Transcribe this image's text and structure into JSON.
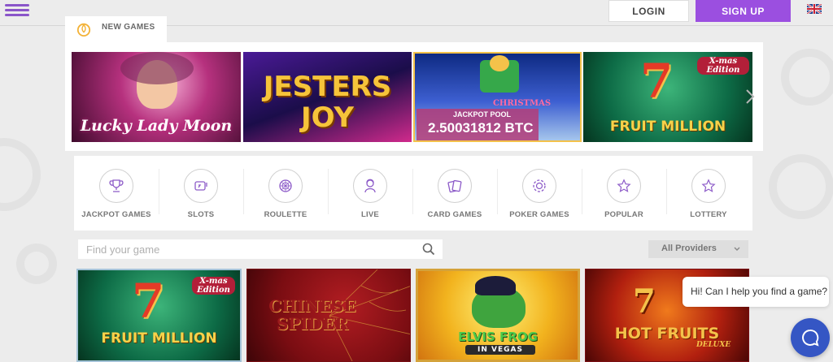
{
  "header": {
    "login_label": "LOGIN",
    "signup_label": "SIGN UP",
    "language_flag": "uk-flag-icon",
    "menu_icon": "hamburger-icon"
  },
  "colors": {
    "accent": "#9b4fe0",
    "menu": "#8a55c9",
    "chat": "#3556c4"
  },
  "new_games": {
    "label": "NEW GAMES",
    "icon": "flame-icon",
    "tiles": [
      {
        "name": "Lucky Lady Moon"
      },
      {
        "name": "JESTERS JOY"
      },
      {
        "name": "CHRISTMAS",
        "jackpot_label": "JACKPOT POOL",
        "jackpot_value": "2.50031812 BTC"
      },
      {
        "name": "FRUIT MILLION",
        "badge": "X-mas Edition"
      }
    ],
    "next_arrow": "chevron-right-icon"
  },
  "categories": [
    {
      "label": "JACKPOT GAMES",
      "icon": "trophy-icon"
    },
    {
      "label": "SLOTS",
      "icon": "slots-icon"
    },
    {
      "label": "ROULETTE",
      "icon": "roulette-icon"
    },
    {
      "label": "LIVE",
      "icon": "dealer-icon"
    },
    {
      "label": "CARD GAMES",
      "icon": "cards-icon"
    },
    {
      "label": "POKER GAMES",
      "icon": "poker-chip-icon"
    },
    {
      "label": "POPULAR",
      "icon": "star-icon"
    },
    {
      "label": "LOTTERY",
      "icon": "star-icon"
    }
  ],
  "search": {
    "placeholder": "Find your game",
    "icon": "search-icon"
  },
  "providers": {
    "selected": "All Providers"
  },
  "games": [
    {
      "name": "FRUIT MILLION",
      "badge": "X-mas Edition"
    },
    {
      "name": "CHINESE SPIDER"
    },
    {
      "name": "ELVIS FROG",
      "sub": "IN VEGAS"
    },
    {
      "name": "HOT FRUITS",
      "sub": "DELUXE"
    }
  ],
  "chat": {
    "message": "Hi! Can I help you find a game?",
    "icon": "chat-icon"
  }
}
